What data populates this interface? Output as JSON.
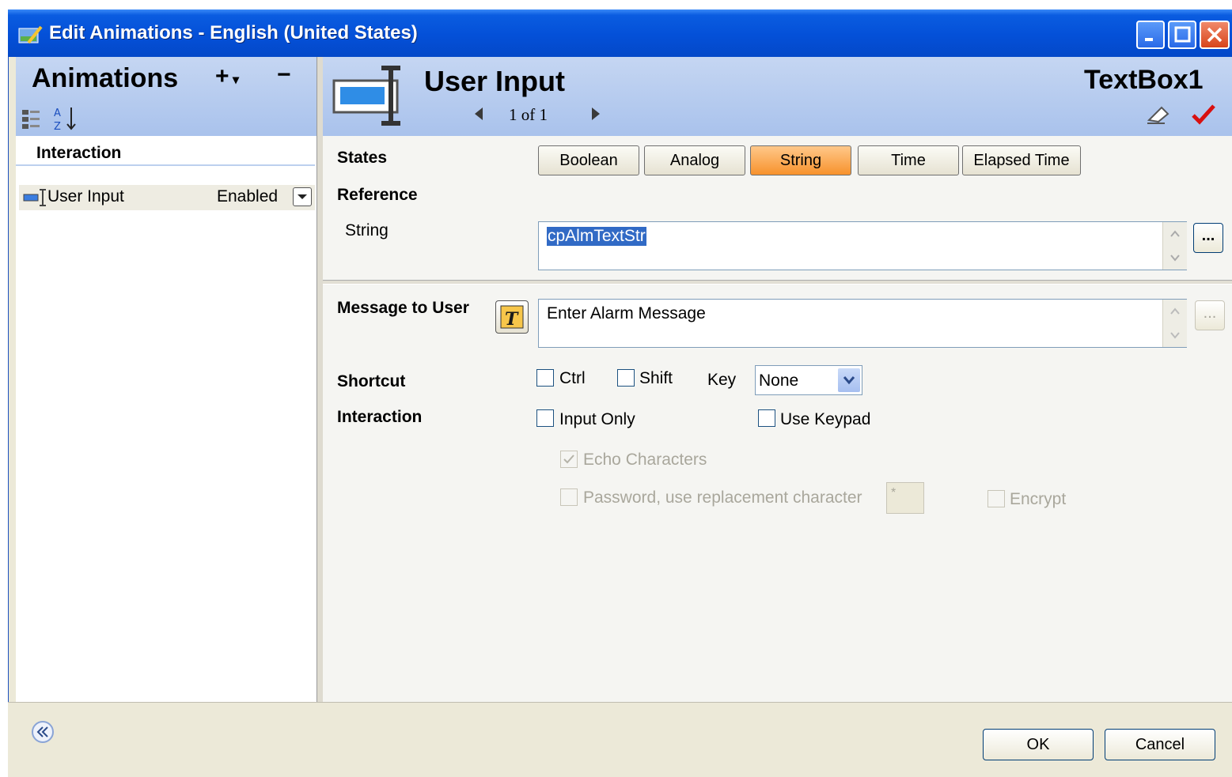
{
  "window": {
    "title": "Edit Animations - English (United States)"
  },
  "left": {
    "heading": "Animations",
    "add_label": "+",
    "remove_label": "−",
    "category": "Interaction",
    "items": [
      {
        "label": "User Input",
        "status": "Enabled"
      }
    ]
  },
  "header": {
    "title": "User Input",
    "pager": "1 of 1",
    "object_name": "TextBox1"
  },
  "states": {
    "label": "States",
    "buttons": [
      "Boolean",
      "Analog",
      "String",
      "Time",
      "Elapsed Time"
    ],
    "selected": "String"
  },
  "reference": {
    "label": "Reference",
    "field_label": "String",
    "value": "cpAlmTextStr",
    "browse_label": "..."
  },
  "message": {
    "label": "Message to User",
    "value": "Enter Alarm Message",
    "browse_label": "..."
  },
  "shortcut": {
    "label": "Shortcut",
    "ctrl_label": "Ctrl",
    "shift_label": "Shift",
    "key_label": "Key",
    "key_value": "None"
  },
  "interaction": {
    "label": "Interaction",
    "input_only_label": "Input Only",
    "use_keypad_label": "Use Keypad",
    "echo_label": "Echo Characters",
    "password_label": "Password, use replacement character",
    "replacement_char": "*",
    "encrypt_label": "Encrypt"
  },
  "footer": {
    "ok_label": "OK",
    "cancel_label": "Cancel"
  },
  "colors": {
    "title_bar": "#0450d8",
    "selected_state": "#f7922c",
    "check_red": "#d81010"
  }
}
